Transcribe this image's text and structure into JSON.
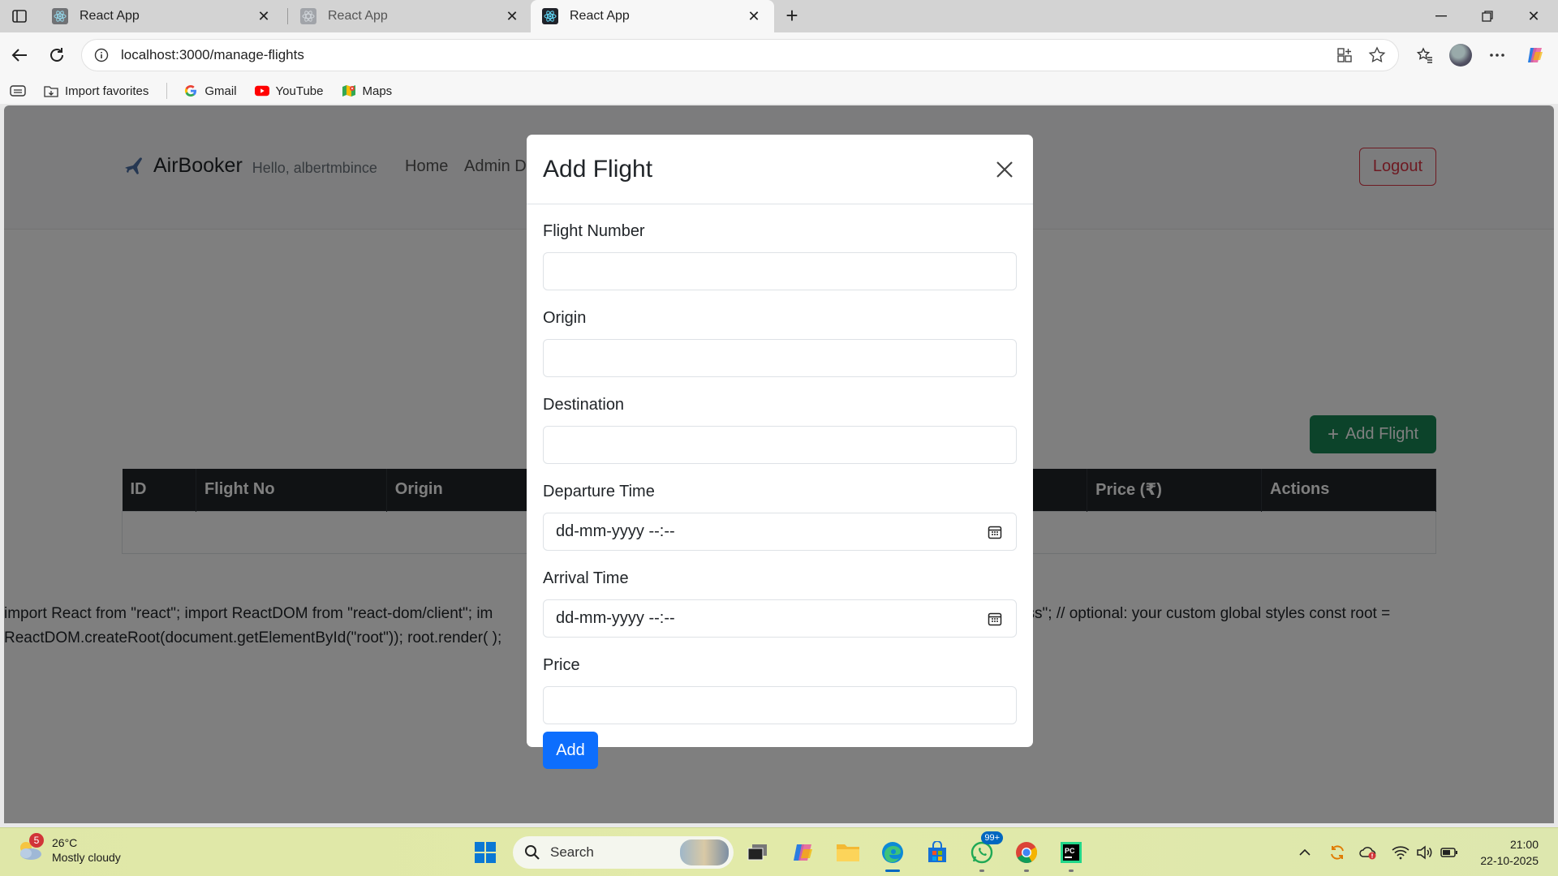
{
  "browser": {
    "tabs": [
      {
        "title": "React App",
        "active": false
      },
      {
        "title": "React App",
        "active": false
      },
      {
        "title": "React App",
        "active": true
      }
    ],
    "url": "localhost:3000/manage-flights",
    "bookmarks": [
      {
        "label": "Import favorites",
        "icon": "import-favorites-icon"
      },
      {
        "label": "Gmail",
        "icon": "google-icon"
      },
      {
        "label": "YouTube",
        "icon": "youtube-icon"
      },
      {
        "label": "Maps",
        "icon": "maps-icon"
      }
    ]
  },
  "app": {
    "brand": "AirBooker",
    "greeting": "Hello, albertmbince",
    "nav": [
      "Home",
      "Admin Da"
    ],
    "logout_label": "Logout",
    "add_flight_label": "Add Flight",
    "table": {
      "headers": [
        "ID",
        "Flight No",
        "Origin",
        "",
        "",
        "Price (₹)",
        "Actions"
      ]
    },
    "raw_text": "import React from \"react\"; import ReactDOM from \"react-dom/client\"; im                                                                                                   import \"./index.css\"; // optional: your custom global styles const root =\nReactDOM.createRoot(document.getElementById(\"root\")); root.render( );"
  },
  "modal": {
    "title": "Add Flight",
    "fields": [
      {
        "label": "Flight Number",
        "type": "text",
        "value": ""
      },
      {
        "label": "Origin",
        "type": "text",
        "value": ""
      },
      {
        "label": "Destination",
        "type": "text",
        "value": ""
      },
      {
        "label": "Departure Time",
        "type": "datetime",
        "value": "dd-mm-yyyy --:--"
      },
      {
        "label": "Arrival Time",
        "type": "datetime",
        "value": "dd-mm-yyyy --:--"
      },
      {
        "label": "Price",
        "type": "number",
        "value": ""
      }
    ],
    "submit_label": "Add"
  },
  "taskbar": {
    "weather_badge": "5",
    "temperature": "26°C",
    "condition": "Mostly cloudy",
    "search_placeholder": "Search",
    "whatsapp_badge": "99+",
    "time": "21:00",
    "date": "22-10-2025"
  },
  "colors": {
    "primary": "#0d6efd",
    "success": "#198754",
    "danger": "#dc3545",
    "table_header": "#212529"
  }
}
